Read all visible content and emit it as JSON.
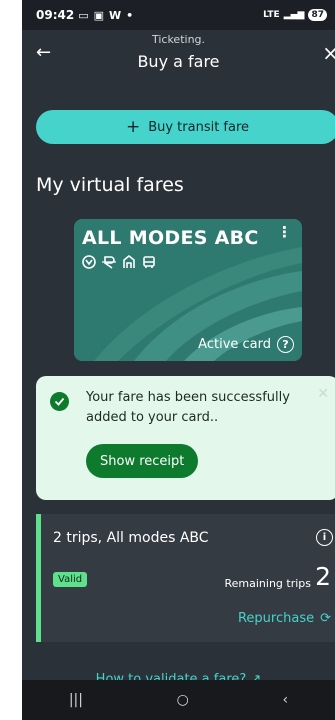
{
  "status": {
    "time": "09:42",
    "icons": [
      "message-icon",
      "image-icon",
      "w-icon",
      "dot"
    ],
    "network": "LTE",
    "battery": "87"
  },
  "header": {
    "subtitle": "Ticketing.",
    "title": "Buy a fare"
  },
  "buy": {
    "label": "Buy transit fare"
  },
  "section": {
    "title": "My virtual fares"
  },
  "card": {
    "name": "ALL MODES ABC",
    "status": "Active card",
    "modes": [
      "metro-icon",
      "train-icon",
      "tram-icon",
      "bus-icon"
    ]
  },
  "toast": {
    "message": "Your fare has been successfully added to your card..",
    "button": "Show receipt"
  },
  "fare": {
    "name": "2 trips, All modes ABC",
    "badge": "Valid",
    "remaining_label": "Remaining trips",
    "remaining": "2",
    "repurchase": "Repurchase"
  },
  "footer": {
    "link": "How to validate a fare?"
  },
  "colors": {
    "accent": "#46d3cb",
    "success": "#0d7a2e",
    "valid": "#5fe08c",
    "background": "#2b3138"
  }
}
